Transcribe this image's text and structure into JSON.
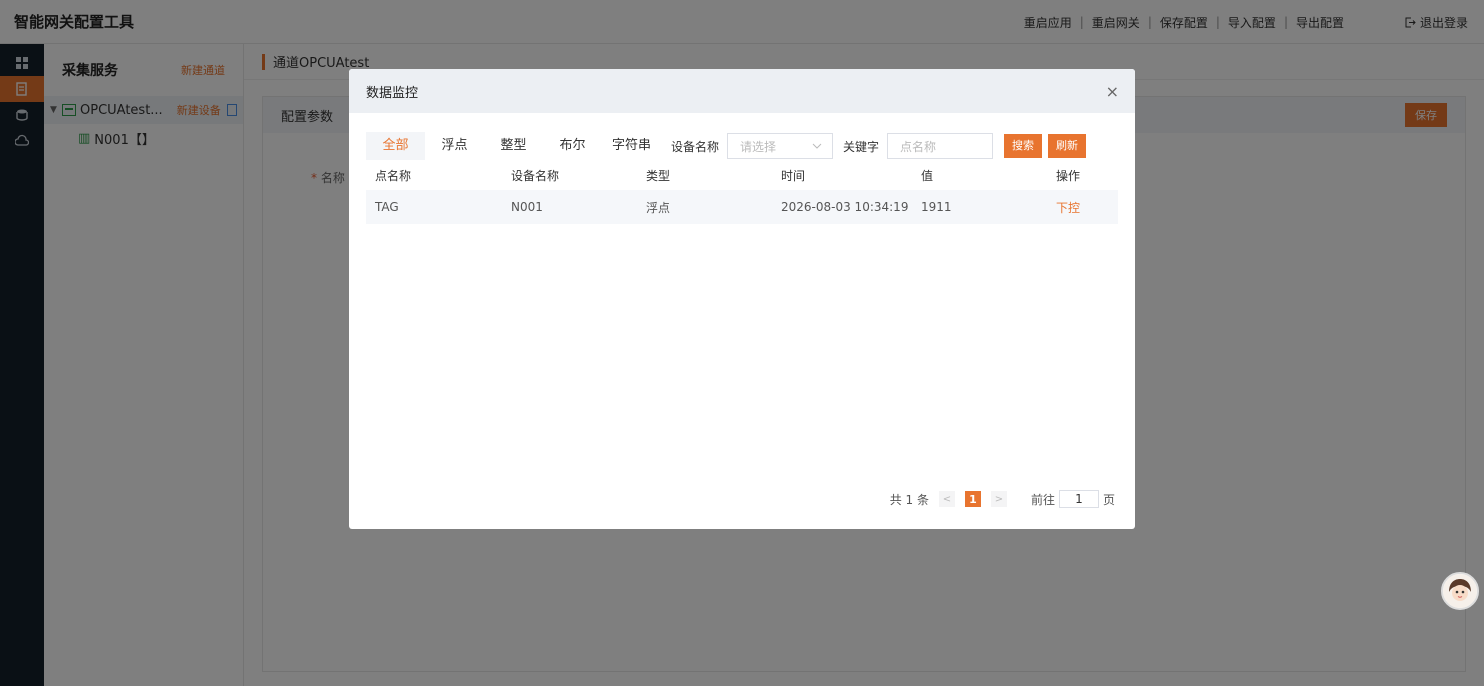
{
  "app": {
    "title": "智能网关配置工具"
  },
  "topbar": {
    "actions": [
      "重启应用",
      "重启网关",
      "保存配置",
      "导入配置",
      "导出配置"
    ],
    "separator": "|",
    "logout": "退出登录"
  },
  "rail": {
    "icons": [
      "dashboard-icon",
      "collect-icon",
      "database-icon",
      "cloud-icon"
    ]
  },
  "tree": {
    "title": "采集服务",
    "new_channel": "新建通道",
    "channel": {
      "label": "OPCUAtest...",
      "action": "新建设备"
    },
    "device": {
      "label": "N001【】"
    }
  },
  "main": {
    "breadcrumb": "通道OPCUAtest",
    "card_title": "配置参数",
    "save": "保存",
    "required_mark": "*",
    "name_label": "名称"
  },
  "dialog": {
    "title": "数据监控",
    "close": "×",
    "tabs": [
      "全部",
      "浮点",
      "整型",
      "布尔",
      "字符串"
    ],
    "device_label": "设备名称",
    "device_placeholder": "请选择",
    "keyword_label": "关键字",
    "keyword_placeholder": "点名称",
    "search": "搜索",
    "refresh": "刷新",
    "columns": [
      "点名称",
      "设备名称",
      "类型",
      "时间",
      "值",
      "操作"
    ],
    "rows": [
      {
        "name": "TAG",
        "device": "N001",
        "type": "浮点",
        "time": "2026-08-03 10:34:19",
        "value": "1911",
        "op": "下控"
      }
    ],
    "pager": {
      "total": "共 1 条",
      "prev": "<",
      "current": "1",
      "next": ">",
      "goto": "前往",
      "page_value": "1",
      "page_unit": "页"
    }
  },
  "colors": {
    "accent": "#e8742f",
    "rail": "#15202b",
    "tree_icon": "#2f9c4a"
  }
}
